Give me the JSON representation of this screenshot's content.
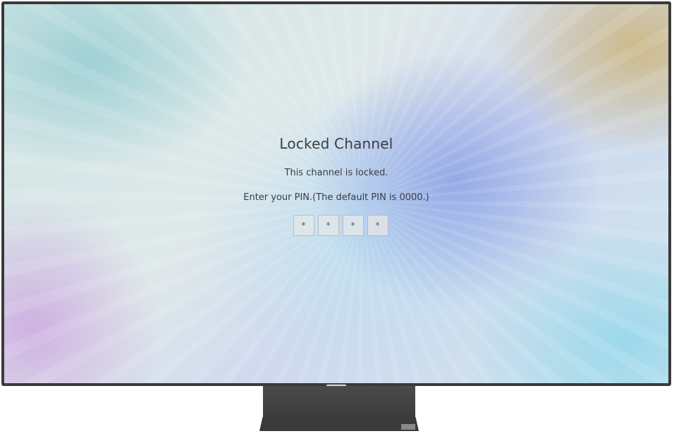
{
  "dialog": {
    "title": "Locked Channel",
    "message": "This channel is locked.",
    "instruction": "Enter your PIN.(The default PIN is 0000.)",
    "pin_slots": [
      "*",
      "*",
      "*",
      "*"
    ]
  },
  "colors": {
    "text": "#3a3d42",
    "bezel": "#3a3a3a",
    "stand": "#3c3c3c"
  }
}
